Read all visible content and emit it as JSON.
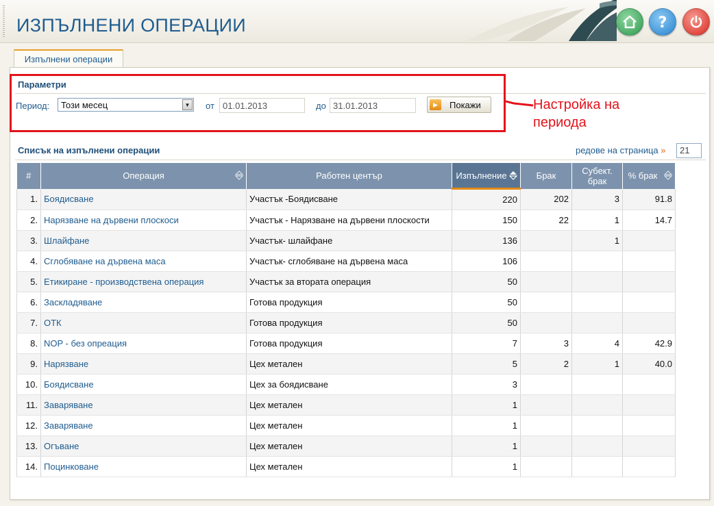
{
  "header": {
    "title": "ИЗПЪЛНЕНИ ОПЕРАЦИИ",
    "buttons": [
      {
        "icon": "home-icon",
        "color": "#3aa35a"
      },
      {
        "icon": "help-icon",
        "color": "#2a8fd6"
      },
      {
        "icon": "power-icon",
        "color": "#e23a2e"
      }
    ]
  },
  "tabs": [
    {
      "label": "Изпълнени операции"
    }
  ],
  "params": {
    "title": "Параметри",
    "period_label": "Период:",
    "period_value": "Този месец",
    "from_label": "от",
    "from_value": "01.01.2013",
    "to_label": "до",
    "to_value": "31.01.2013",
    "show_button": "Покажи"
  },
  "annotation": {
    "text": "Настройка на периода",
    "color": "#e3131b"
  },
  "list": {
    "title": "Списък на изпълнени операции",
    "rows_per_page_label": "редове на страница",
    "rows_per_page_value": "21",
    "columns": [
      "#",
      "Операция",
      "Работен център",
      "Изпълнение",
      "Брак",
      "Субект. брак",
      "% брак"
    ],
    "rows": [
      {
        "n": "1.",
        "op": "Боядисване",
        "wc": "Участък -Боядисване",
        "done": "220",
        "scrap": "202",
        "subj": "3",
        "pct": "91.8"
      },
      {
        "n": "2.",
        "op": "Нарязване на дървени плоскоси",
        "wc": "Участък - Нарязване на дървени плоскости",
        "done": "150",
        "scrap": "22",
        "subj": "1",
        "pct": "14.7"
      },
      {
        "n": "3.",
        "op": "Шлайфане",
        "wc": "Участък- шлайфане",
        "done": "136",
        "scrap": "",
        "subj": "1",
        "pct": ""
      },
      {
        "n": "4.",
        "op": "Сглобяване на дървена маса",
        "wc": "Участък- сглобяване на дървена маса",
        "done": "106",
        "scrap": "",
        "subj": "",
        "pct": ""
      },
      {
        "n": "5.",
        "op": "Етикиране - производствена операция",
        "wc": "Участък за втората операция",
        "done": "50",
        "scrap": "",
        "subj": "",
        "pct": ""
      },
      {
        "n": "6.",
        "op": "Заскладяване",
        "wc": "Готова продукция",
        "done": "50",
        "scrap": "",
        "subj": "",
        "pct": ""
      },
      {
        "n": "7.",
        "op": "ОТК",
        "wc": "Готова продукция",
        "done": "50",
        "scrap": "",
        "subj": "",
        "pct": ""
      },
      {
        "n": "8.",
        "op": "NOP - без опреация",
        "wc": "Готова продукция",
        "done": "7",
        "scrap": "3",
        "subj": "4",
        "pct": "42.9"
      },
      {
        "n": "9.",
        "op": "Нарязване",
        "wc": "Цех метален",
        "done": "5",
        "scrap": "2",
        "subj": "1",
        "pct": "40.0"
      },
      {
        "n": "10.",
        "op": "Боядисване",
        "wc": "Цех за боядисване",
        "done": "3",
        "scrap": "",
        "subj": "",
        "pct": ""
      },
      {
        "n": "11.",
        "op": "Заваряване",
        "wc": "Цех метален",
        "done": "1",
        "scrap": "",
        "subj": "",
        "pct": ""
      },
      {
        "n": "12.",
        "op": "Заваряване",
        "wc": "Цех метален",
        "done": "1",
        "scrap": "",
        "subj": "",
        "pct": ""
      },
      {
        "n": "13.",
        "op": "Огъване",
        "wc": "Цех метален",
        "done": "1",
        "scrap": "",
        "subj": "",
        "pct": ""
      },
      {
        "n": "14.",
        "op": "Поцинковане",
        "wc": "Цех метален",
        "done": "1",
        "scrap": "",
        "subj": "",
        "pct": ""
      }
    ]
  }
}
